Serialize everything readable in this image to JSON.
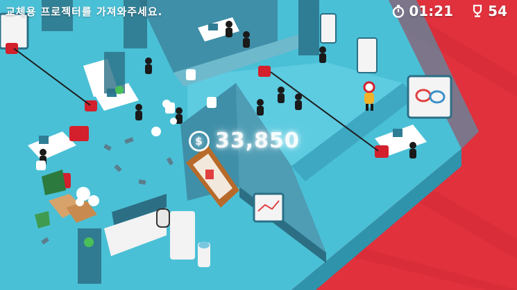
{
  "hud": {
    "objective": "교체용 프로젝터를 가져와주세요.",
    "timer": "01:21",
    "goal_count": "54",
    "money": "33,850"
  },
  "colors": {
    "background": "#e0313d",
    "floor": "#4ac0d6",
    "wall": "#3f8fa8",
    "money_text": "#ffffff"
  },
  "icons": {
    "timer": "stopwatch-icon",
    "goal": "trophy-icon",
    "money": "dollar-coin-icon"
  }
}
